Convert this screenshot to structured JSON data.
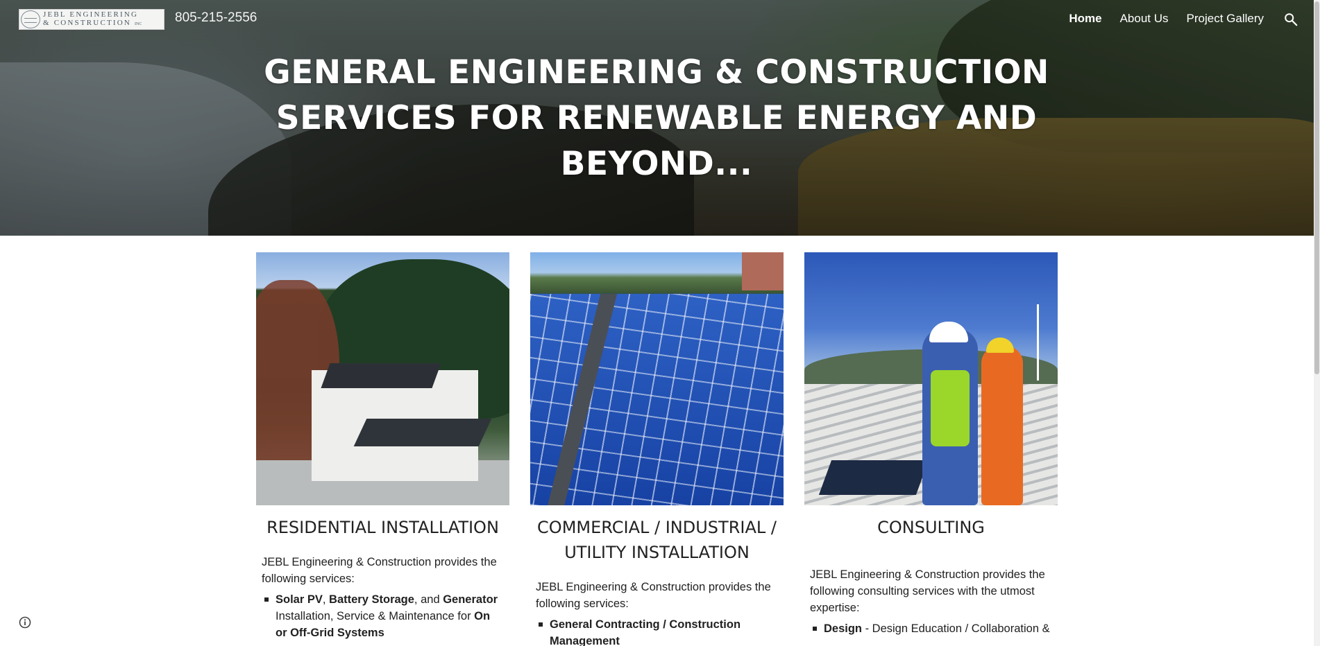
{
  "header": {
    "logo_line1": "JEBL ENGINEERING",
    "logo_line2": "& CONSTRUCTION",
    "logo_suffix": "INC",
    "phone": "805-215-2556",
    "nav": [
      {
        "label": "Home",
        "active": true
      },
      {
        "label": "About Us",
        "active": false
      },
      {
        "label": "Project Gallery",
        "active": false
      }
    ],
    "search_icon": "search-icon"
  },
  "hero": {
    "title": "GENERAL ENGINEERING & CONSTRUCTION SERVICES FOR RENEWABLE ENERGY AND BEYOND..."
  },
  "cards": [
    {
      "title": "RESIDENTIAL INSTALLATION",
      "intro": "JEBL Engineering & Construction provides the following services:",
      "item": {
        "p1": "Solar PV",
        "p2": ", ",
        "p3": "Battery Storage",
        "p4": ", and ",
        "p5": "Generator",
        "p6": " Installation, Service & Maintenance for ",
        "p7": "On or Off-Grid Systems"
      }
    },
    {
      "title": "COMMERCIAL / INDUSTRIAL / UTILITY INSTALLATION",
      "intro": "JEBL Engineering & Construction provides the following services:",
      "item": {
        "p1": "General Contracting / Construction Management"
      }
    },
    {
      "title": "CONSULTING",
      "intro": "JEBL Engineering & Construction provides the following consulting services with the utmost expertise:",
      "item": {
        "p1": "Design",
        "p2": " - Design Education / Collaboration &"
      }
    }
  ],
  "footer": {
    "info_icon": "info-icon"
  },
  "colors": {
    "nav_text": "#ffffff",
    "body_text": "#212121",
    "background": "#ffffff"
  }
}
